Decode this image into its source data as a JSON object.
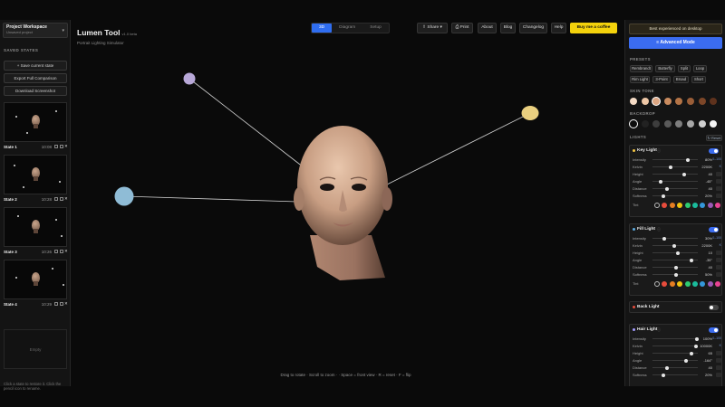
{
  "workspace": {
    "title": "Project Workspace",
    "subtitle": "Unsaved project"
  },
  "left": {
    "saved_states_label": "SAVED STATES",
    "save_btn": "+ Save current state",
    "export_btn": "Export Full Comparison",
    "download_btn": "Download Screenshot",
    "states": [
      {
        "name": "State 1",
        "time": "10:08"
      },
      {
        "name": "State 2",
        "time": "10:28"
      },
      {
        "name": "State 3",
        "time": "10:26"
      },
      {
        "name": "State 4",
        "time": "10:29"
      }
    ],
    "empty_label": "Empty",
    "hint": "Click a state to restore it. Click the pencil icon to rename."
  },
  "brand": {
    "name": "Lumen Tool",
    "version": "v1.0 beta",
    "subtitle": "Portrait Lighting Simulator"
  },
  "view_tabs": [
    "3D",
    "Diagram",
    "Setup"
  ],
  "topbar": {
    "share": "Share",
    "print": "Print",
    "about": "About",
    "blog": "Blog",
    "changelog": "Changelog",
    "help": "Help",
    "coffee": "Buy me a coffee"
  },
  "viewport": {
    "footer": "Drag to rotate · Scroll to zoom · · Space = front view · R = reset · F = flip",
    "light_colors": {
      "back_left": "#b8a8d8",
      "right": "#ead080",
      "left": "#8fbcd6"
    }
  },
  "right": {
    "desktop_notice": "Best experienced on desktop",
    "advanced_btn": "Advanced Mode",
    "presets_label": "PRESETS",
    "presets": [
      "Rembrandt",
      "Butterfly",
      "Split",
      "Loop",
      "Rim Light",
      "3-Point",
      "Broad",
      "Short"
    ],
    "skin_label": "SKIN TONE",
    "skin_tones": [
      "#f6dcc6",
      "#eec7a6",
      "#dba582",
      "#c98b5f",
      "#b47446",
      "#9a5e38",
      "#7c4628",
      "#5e321d"
    ],
    "backdrop_label": "BACKDROP",
    "backdrops": [
      "#0d0d0d",
      "#222222",
      "#3d3d3d",
      "#5a5a5a",
      "#7e7e7e",
      "#a8a8a8",
      "#d0d0d0",
      "#f4f4f4"
    ],
    "lights_label": "LIGHTS",
    "reset": "↻ Reset",
    "tint_colors": [
      "#f0f0f0",
      "#e74c3c",
      "#e67e22",
      "#f1c40f",
      "#2ecc71",
      "#1abc9c",
      "#3498db",
      "#9b59b6",
      "#e84393"
    ],
    "key": {
      "title": "Key Light",
      "color": "#f4c542",
      "rows": [
        {
          "label": "Intensity",
          "value": "80%",
          "unit": "0–100",
          "pct": 0.78
        },
        {
          "label": "Kelvin",
          "value": "2200K",
          "unit": "K",
          "pct": 0.38
        },
        {
          "label": "Height",
          "value": "40",
          "unit": "",
          "pct": 0.68
        },
        {
          "label": "Angle",
          "value": "-45°",
          "unit": "",
          "pct": 0.15
        },
        {
          "label": "Distance",
          "value": "40",
          "unit": "",
          "pct": 0.3
        },
        {
          "label": "Softness",
          "value": "20%",
          "unit": "",
          "pct": 0.2
        }
      ],
      "tint_label": "Tint"
    },
    "fill": {
      "title": "Fill Light",
      "color": "#5dade2",
      "rows": [
        {
          "label": "Intensity",
          "value": "30%",
          "unit": "0–100",
          "pct": 0.22
        },
        {
          "label": "Kelvin",
          "value": "2200K",
          "unit": "K",
          "pct": 0.45
        },
        {
          "label": "Height",
          "value": "10",
          "unit": "",
          "pct": 0.55
        },
        {
          "label": "Angle",
          "value": "-35°",
          "unit": "",
          "pct": 0.85
        },
        {
          "label": "Distance",
          "value": "40",
          "unit": "",
          "pct": 0.5
        },
        {
          "label": "Softness",
          "value": "50%",
          "unit": "",
          "pct": 0.5
        }
      ],
      "tint_label": "Tint"
    },
    "back": {
      "title": "Back Light",
      "color": "#e74c3c"
    },
    "hair": {
      "title": "Hair Light",
      "color": "#a29bfe",
      "rows": [
        {
          "label": "Intensity",
          "value": "100%",
          "unit": "0–100",
          "pct": 0.98
        },
        {
          "label": "Kelvin",
          "value": "10000K",
          "unit": "K",
          "pct": 0.95
        },
        {
          "label": "Height",
          "value": "65",
          "unit": "",
          "pct": 0.85
        },
        {
          "label": "Angle",
          "value": "-164°",
          "unit": "",
          "pct": 0.72
        },
        {
          "label": "Distance",
          "value": "40",
          "unit": "",
          "pct": 0.3
        },
        {
          "label": "Softness",
          "value": "20%",
          "unit": "",
          "pct": 0.2
        }
      ]
    }
  }
}
